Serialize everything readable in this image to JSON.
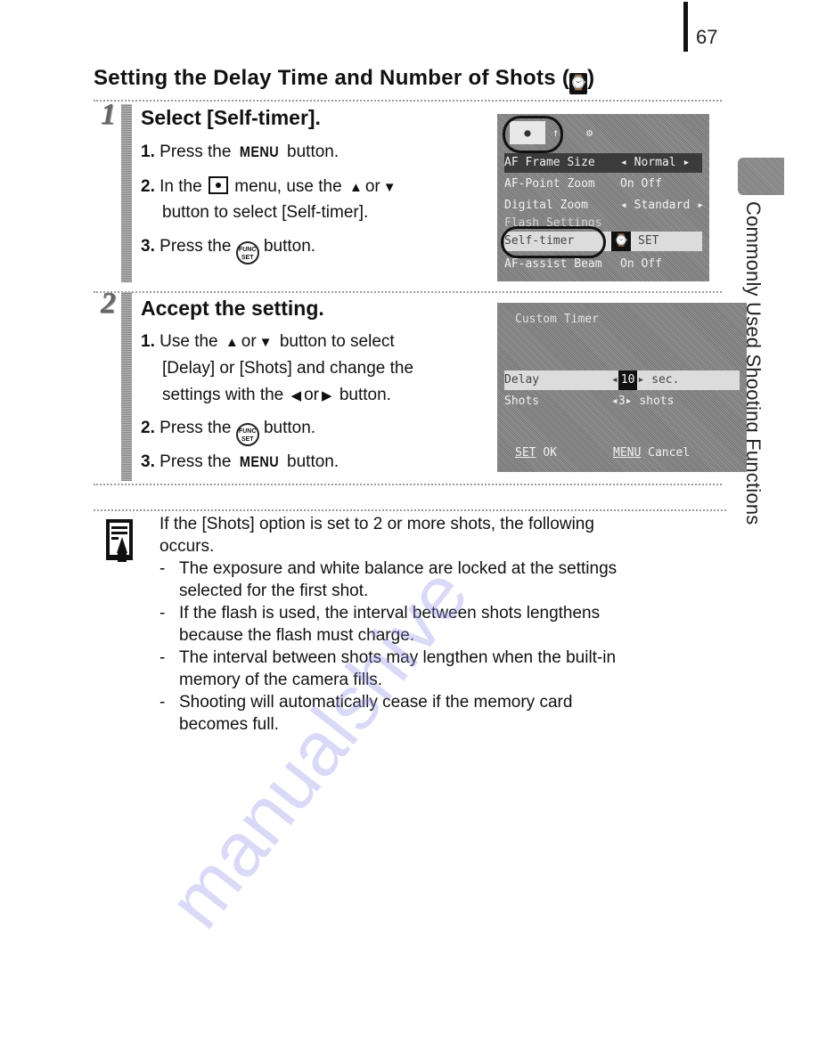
{
  "page": {
    "number": "67",
    "side_tab_label": "Commonly Used Shooting Functions",
    "watermark": "manualshive"
  },
  "section": {
    "title": "Setting the Delay Time and Number of Shots (",
    "title_suffix": ")",
    "title_icon": "self-timer-custom-icon"
  },
  "steps": [
    {
      "number": "1",
      "heading": "Select [Self-timer].",
      "items": [
        {
          "n": "1.",
          "pre": "Press the",
          "key": "MENU",
          "post": "button."
        },
        {
          "n": "2.",
          "pre": "In the",
          "icon": "camera-menu-icon",
          "mid": "menu, use the",
          "a1": "▲",
          "or": "or",
          "a2": "▼",
          "cont": "button to select [Self-timer]."
        },
        {
          "n": "3.",
          "pre": "Press the",
          "key": "FUNC SET",
          "post": "button."
        }
      ],
      "screen": {
        "tabs": [
          "●",
          "↑↓",
          "⚙"
        ],
        "rows": [
          {
            "label": "AF Frame Size",
            "value": "◂ Normal ▸"
          },
          {
            "label": "AF-Point Zoom",
            "value": "On  Off"
          },
          {
            "label": "Digital Zoom",
            "value": "◂ Standard ▸"
          },
          {
            "label": "Flash Settings",
            "value": ""
          },
          {
            "label": "Self-timer",
            "value": "SET"
          },
          {
            "label": "AF-assist Beam",
            "value": "On  Off"
          }
        ]
      }
    },
    {
      "number": "2",
      "heading": "Accept the setting.",
      "items": [
        {
          "n": "1.",
          "pre": "Use the",
          "a1": "▲",
          "or": "or",
          "a2": "▼",
          "post": "button to select",
          "cont1": "[Delay] or [Shots] and change the",
          "cont2_pre": "settings with the",
          "a3": "◀",
          "or2": "or",
          "a4": "▶",
          "cont2_post": "button."
        },
        {
          "n": "2.",
          "pre": "Press the",
          "key": "FUNC SET",
          "post": "button."
        },
        {
          "n": "3.",
          "pre": "Press the",
          "key": "MENU",
          "post": "button."
        }
      ],
      "screen": {
        "title": "Custom Timer",
        "rows": [
          {
            "label": "Delay",
            "value": "10",
            "unit": "sec."
          },
          {
            "label": "Shots",
            "value": "3",
            "unit": "shots"
          }
        ],
        "footer_ok_key": "SET",
        "footer_ok": "OK",
        "footer_cancel_key": "MENU",
        "footer_cancel": "Cancel"
      }
    }
  ],
  "note": {
    "intro": "If the [Shots] option is set to 2 or more shots, the following",
    "intro2": "occurs.",
    "bullets": [
      {
        "l1": "The exposure and white balance are locked at the settings",
        "l2": "selected for the first shot."
      },
      {
        "l1": "If the flash is used, the interval between shots lengthens",
        "l2": "because the flash must charge."
      },
      {
        "l1": "The interval between shots may lengthen when the built-in",
        "l2": "memory of the camera fills."
      },
      {
        "l1": "Shooting will automatically cease if the memory card",
        "l2": "becomes full."
      }
    ]
  }
}
